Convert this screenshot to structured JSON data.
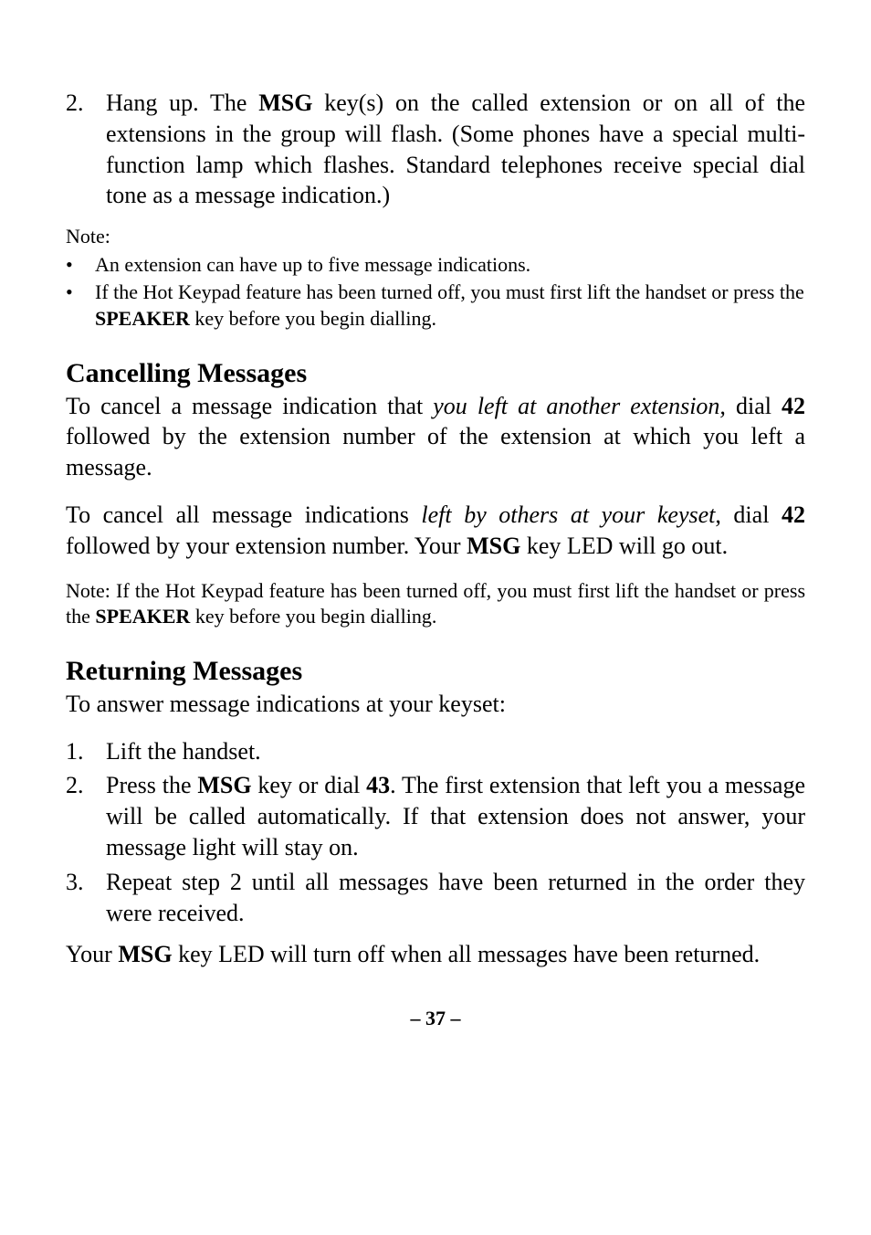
{
  "step2": {
    "num": "2.",
    "text_before_msg": "Hang up. The ",
    "msg": "MSG",
    "text_after_msg": " key(s) on the called extension or on all of the extensions in the group will flash. (Some phones have a special multi-function lamp which flashes. Standard telephones receive special dial tone as a message indication.)"
  },
  "note1": {
    "label": "Note:",
    "b1": "An extension can have up to five message indications.",
    "b2_before": "If the Hot Keypad feature has been turned off, you must first lift the handset or press the ",
    "b2_speaker": "SPEAKER",
    "b2_after": " key before you begin dialling."
  },
  "cancel": {
    "heading": "Cancelling Messages",
    "p1_a": "To cancel a message indication that ",
    "p1_i": "you left at another extension,",
    "p1_b": " dial ",
    "p1_42": "42",
    "p1_c": " followed by the extension number of the extension at which you left a message.",
    "p2_a": "To cancel all message indications ",
    "p2_i": "left by others at your keyset",
    "p2_b": ", dial ",
    "p2_42": "42",
    "p2_c": " followed by your extension number. Your ",
    "p2_msg": "MSG",
    "p2_d": " key ",
    "p2_led": "LED",
    "p2_e": " will go out.",
    "note_a": "Note: If the Hot Keypad feature has been turned off, you must first lift the handset or press the ",
    "note_speaker": "SPEAKER",
    "note_b": " key before you begin dialling."
  },
  "returning": {
    "heading": "Returning Messages",
    "intro": "To answer message indications at your keyset:",
    "s1_num": "1.",
    "s1_text": "Lift the handset.",
    "s2_num": "2.",
    "s2_a": "Press the ",
    "s2_msg": "MSG",
    "s2_b": " key or dial ",
    "s2_43": "43",
    "s2_c": ". The first extension that left you a message will be called automatically. If that extension does not answer, your message light will stay on.",
    "s3_num": "3.",
    "s3_text": "Repeat step 2 until all messages have been returned in the order they were received.",
    "final_a": "Your ",
    "final_msg": "MSG",
    "final_b": " key ",
    "final_led": "LED",
    "final_c": " will turn off when all messages have been re­turned."
  },
  "footer": "– 37 –"
}
